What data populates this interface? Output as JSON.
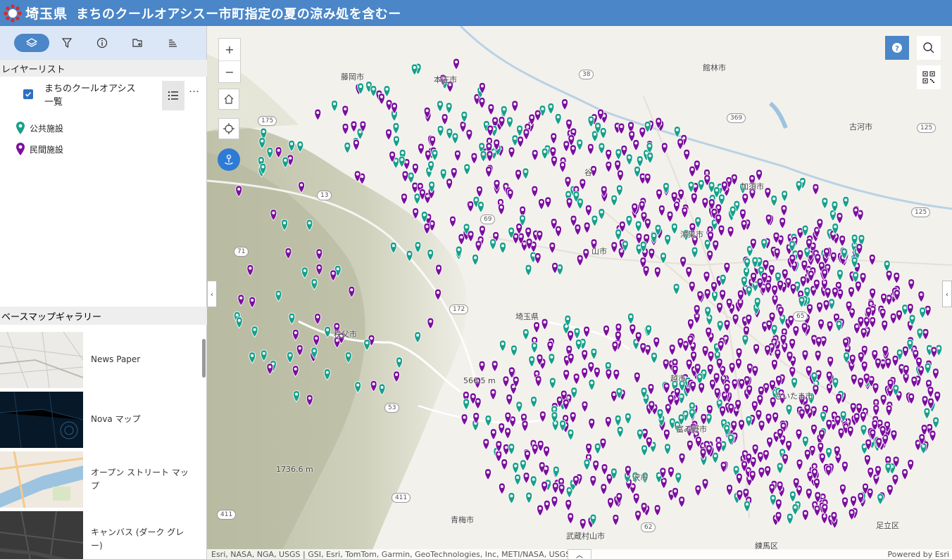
{
  "header": {
    "prefecture": "埼玉県",
    "title": "まちのクールオアシスー市町指定の夏の涼み処を含むー",
    "bg_color": "#4a86c8"
  },
  "toolbar": {
    "tools": [
      "layers-icon",
      "filter-icon",
      "info-icon",
      "add-data-icon",
      "legend-icon"
    ],
    "active": "layers-icon"
  },
  "layer_list": {
    "heading": "レイヤーリスト",
    "layer": {
      "name": "まちのクールオアシス一覧",
      "checked": true,
      "more": "…"
    },
    "legend": [
      {
        "label": "公共施設",
        "color": "#17a08a"
      },
      {
        "label": "民間施設",
        "color": "#7b0f9e"
      }
    ]
  },
  "basemap": {
    "heading": "ベースマップギャラリー",
    "items": [
      {
        "label": "News Paper"
      },
      {
        "label": "Nova マップ"
      },
      {
        "label": "オープン ストリート マップ"
      },
      {
        "label": "キャンバス (ダーク グレー)"
      }
    ]
  },
  "map": {
    "places": [
      "藤岡市",
      "本庄市",
      "館林市",
      "古河市",
      "加須市",
      "鴻巣市",
      "秩父市",
      "青梅市",
      "武蔵村山市",
      "足立区",
      "練馬区",
      "さいたま市",
      "越市",
      "富み野市",
      "沢市",
      "谷",
      "山市",
      "埼玉県",
      "1736.6 m",
      "566.5 m"
    ],
    "routes": [
      "38",
      "175",
      "369",
      "125",
      "13",
      "69",
      "71",
      "172",
      "65",
      "53",
      "411",
      "62",
      "125",
      "411"
    ],
    "controls": {
      "zoom_in": "+",
      "zoom_out": "−",
      "help": "?"
    },
    "attribution": "Esri, NASA, NGA, USGS | GSI, Esri, TomTom, Garmin, GeoTechnologies, Inc, METI/NASA, USGS",
    "powered_by": "Powered by Esri",
    "public_color": "#17a08a",
    "private_color": "#7b0f9e"
  }
}
